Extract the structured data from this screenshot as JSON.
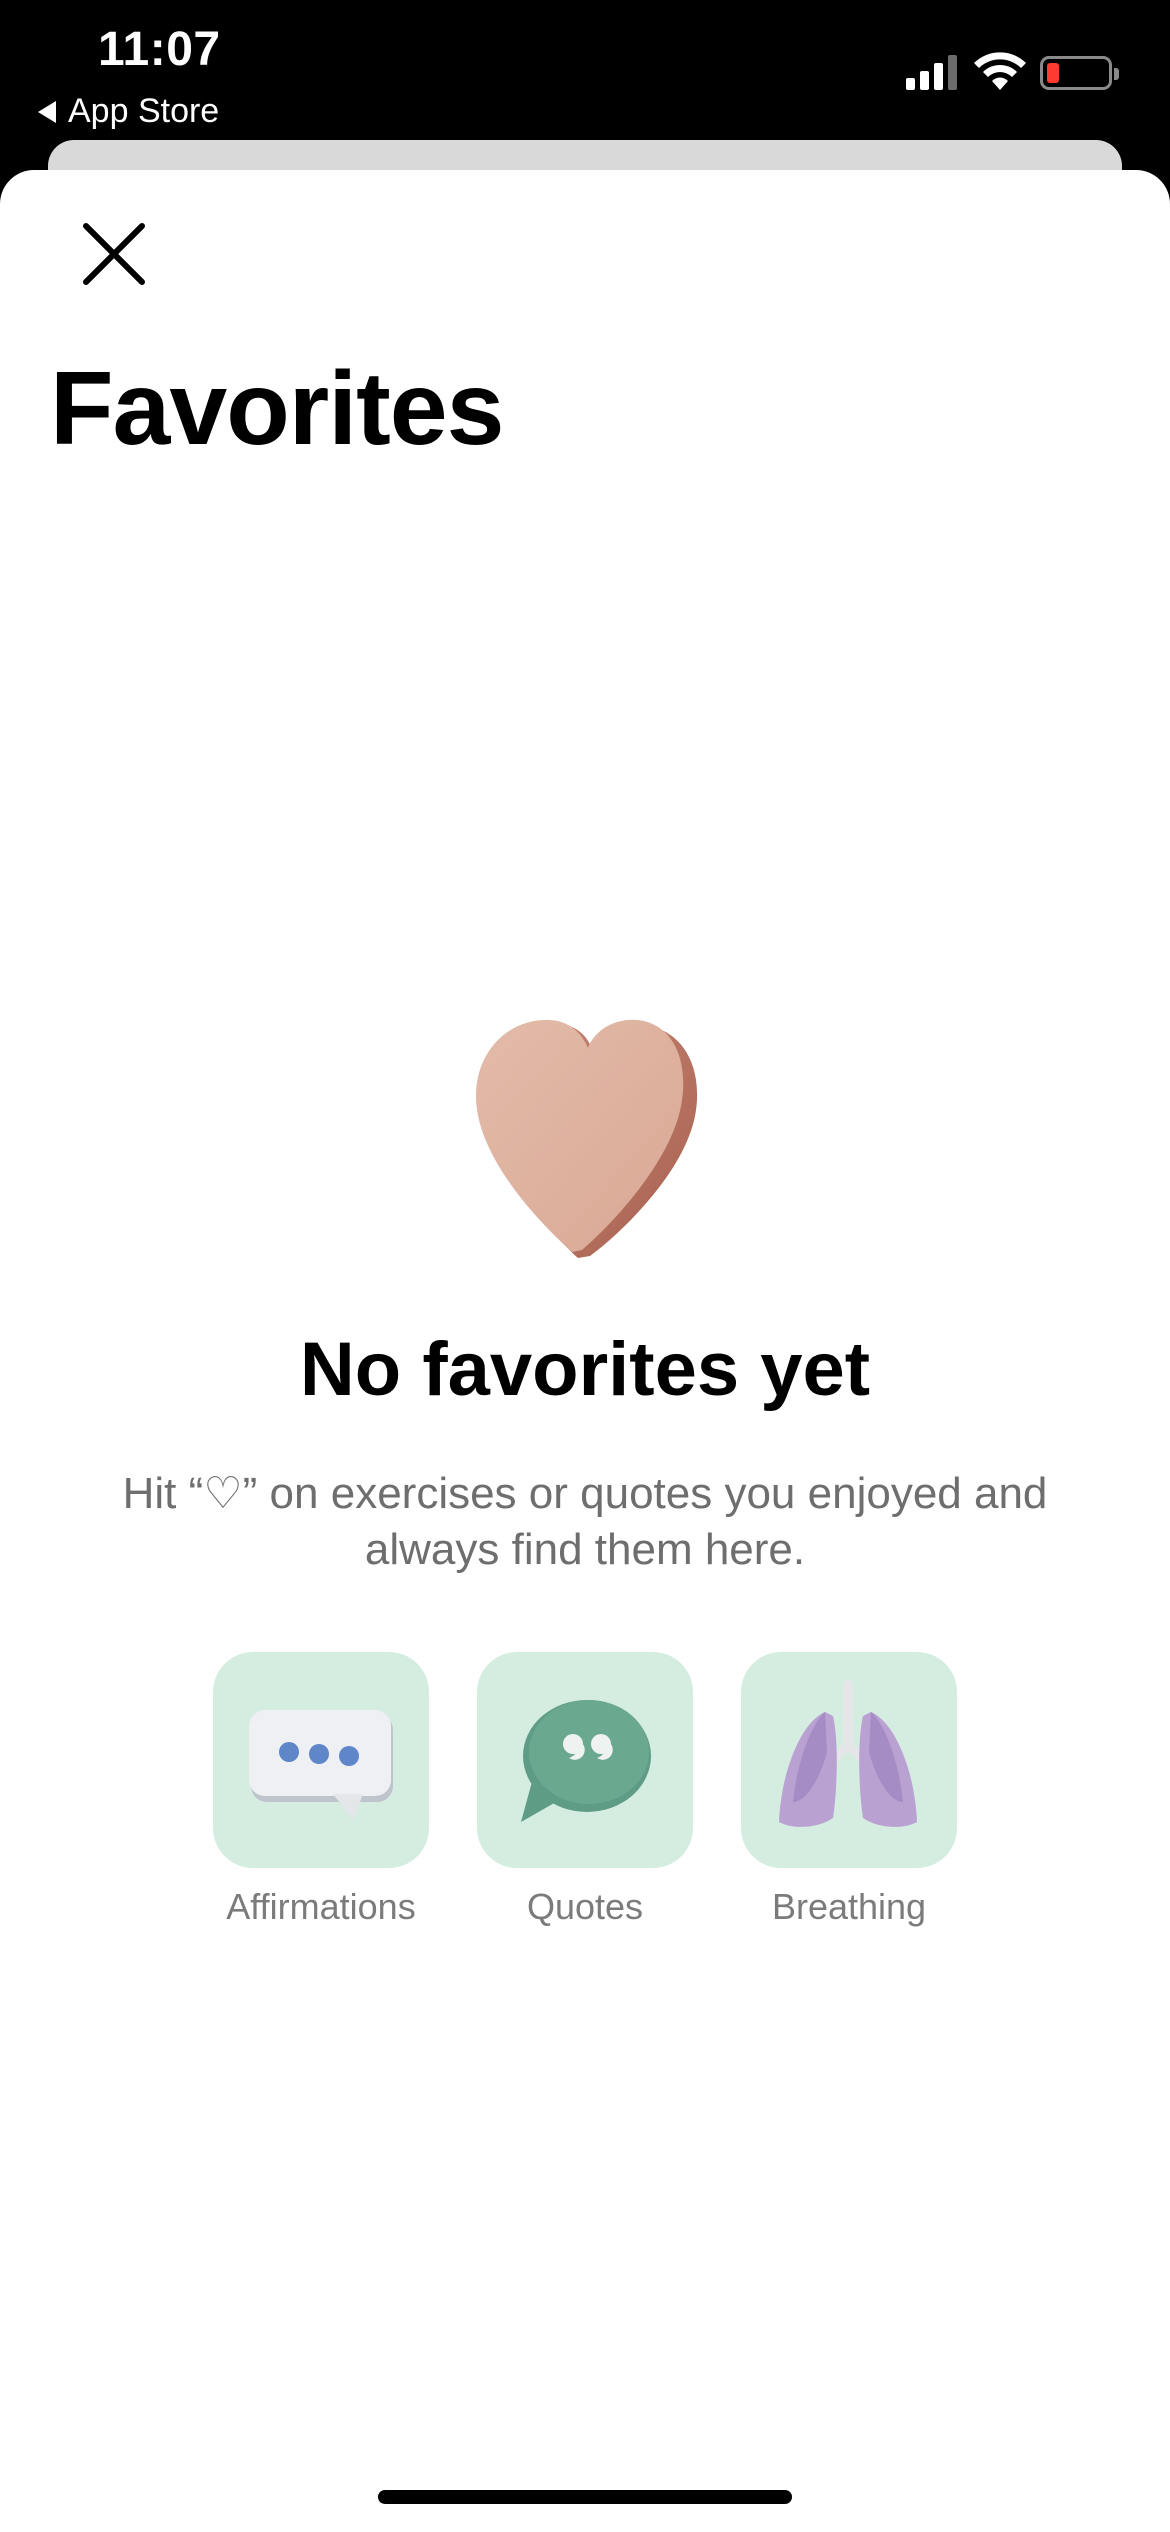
{
  "status_bar": {
    "time": "11:07",
    "back_app": "App Store",
    "icons": [
      "cellular-signal-icon",
      "wifi-icon",
      "battery-low-icon"
    ],
    "battery_color": "#ff3b30"
  },
  "header": {
    "close_icon": "close-icon",
    "title": "Favorites"
  },
  "empty_state": {
    "icon": "heart-illustration",
    "heart_color": "#dcae9c",
    "title": "No favorites yet",
    "description": "Hit “♡” on exercises or quotes you enjoyed and always find them here."
  },
  "categories": [
    {
      "label": "Affirmations",
      "icon": "speech-bubble-dots-icon"
    },
    {
      "label": "Quotes",
      "icon": "quote-bubble-icon"
    },
    {
      "label": "Breathing",
      "icon": "lungs-icon"
    }
  ],
  "colors": {
    "tile_bg": "#d5ece1",
    "muted_text": "#7b7b7b"
  }
}
